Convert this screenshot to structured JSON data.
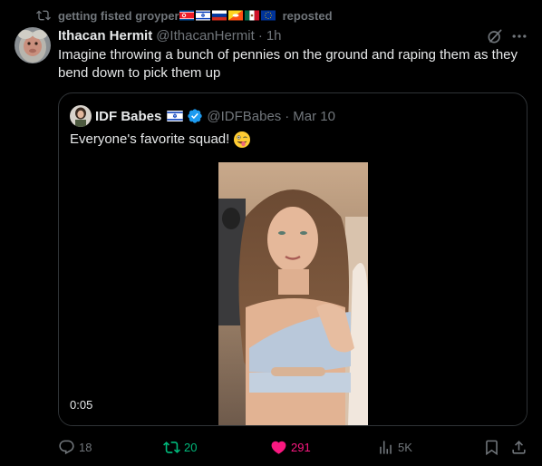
{
  "repost": {
    "user": "getting fisted groyper",
    "suffix": "reposted",
    "flags": [
      "north-korea-flag",
      "israel-flag",
      "russia-flag",
      "bhutan-flag",
      "mexico-flag",
      "eu-flag"
    ]
  },
  "tweet": {
    "display_name": "Ithacan Hermit",
    "handle": "@IthacanHermit",
    "separator": "·",
    "time": "1h",
    "text": "Imagine throwing a bunch of pennies on the ground and raping them as they bend down to pick them up"
  },
  "quote": {
    "display_name": "IDF Babes",
    "flag": "israel-flag",
    "verified": true,
    "handle": "@IDFBabes",
    "separator": "·",
    "time": "Mar 10",
    "text": "Everyone's favorite squad!",
    "emoji": "winking-face-with-tongue-emoji",
    "video_duration": "0:05"
  },
  "actions": {
    "replies": "18",
    "reposts": "20",
    "likes": "291",
    "views": "5K"
  },
  "colors": {
    "background": "#000000",
    "text_primary": "#e7e9ea",
    "text_secondary": "#71767b",
    "border": "#2f3336",
    "repost_active": "#00ba7c",
    "like_active": "#f91880",
    "verified": "#1d9bf0"
  }
}
